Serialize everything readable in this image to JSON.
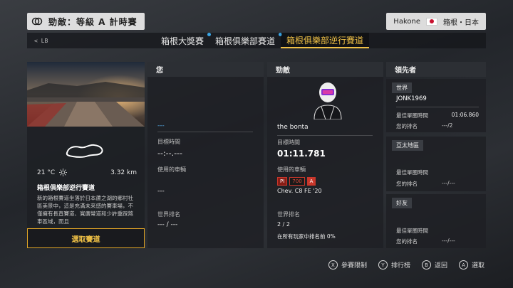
{
  "header": {
    "title": "勁敵：等級 A 計時賽",
    "location_short": "Hakone",
    "location_full": "箱根・日本"
  },
  "tabs": {
    "back_label": "< LB",
    "items": [
      {
        "label": "箱根大獎賽",
        "new": true
      },
      {
        "label": "箱根俱樂部賽道",
        "new": true
      },
      {
        "label": "箱根俱樂部逆行賽道",
        "new": false,
        "active": true
      }
    ]
  },
  "track": {
    "temperature": "21 °C",
    "weather_icon": "sun-icon",
    "length": "3.32 km",
    "name": "箱根俱樂部逆行賽道",
    "description": "新的箱根賽道坐落於日本蘆之湖的鄉村社區美景中，這是充滿未來感的賽車場，不僅擁有長直賽道、寬廣彎道和少許重踩煞車區域，而且",
    "select_label": "選取賽道"
  },
  "you": {
    "header": "您",
    "player_name": "---",
    "target_time_label": "目標時間",
    "target_time": "--:--.---",
    "car_label": "使用的車輛",
    "car": "---",
    "world_rank_label": "世界排名",
    "world_rank": "--- / ---"
  },
  "rival": {
    "header": "勁敵",
    "player_name": "the bonta",
    "target_time_label": "目標時間",
    "target_time": "01:11.781",
    "car_label": "使用的車輛",
    "car_pi": "PI",
    "car_pi_value": "700",
    "car_class": "A",
    "car": "Chev. C8 FE '20",
    "world_rank_label": "世界排名",
    "world_rank": "2 / 2",
    "percentile": "在所有玩家中排名前 0%"
  },
  "leaders": {
    "header": "領先者",
    "world": {
      "label": "世界",
      "gamertag": "JONK1969",
      "best_lap_label": "最佳單圈時間",
      "best_lap": "01:06.860",
      "rank_label": "您的排名",
      "rank": "---/2"
    },
    "asia": {
      "label": "亞太地區",
      "best_lap_label": "最佳單圈時間",
      "rank_label": "您的排名",
      "rank": "---/---"
    },
    "friends": {
      "label": "好友",
      "best_lap_label": "最佳單圈時間",
      "rank_label": "您的排名",
      "rank": "---/---"
    }
  },
  "footer": {
    "hints": [
      {
        "button": "X",
        "label": "參賽限制"
      },
      {
        "button": "Y",
        "label": "排行榜"
      },
      {
        "button": "B",
        "label": "返回"
      },
      {
        "button": "A",
        "label": "選取"
      }
    ]
  }
}
